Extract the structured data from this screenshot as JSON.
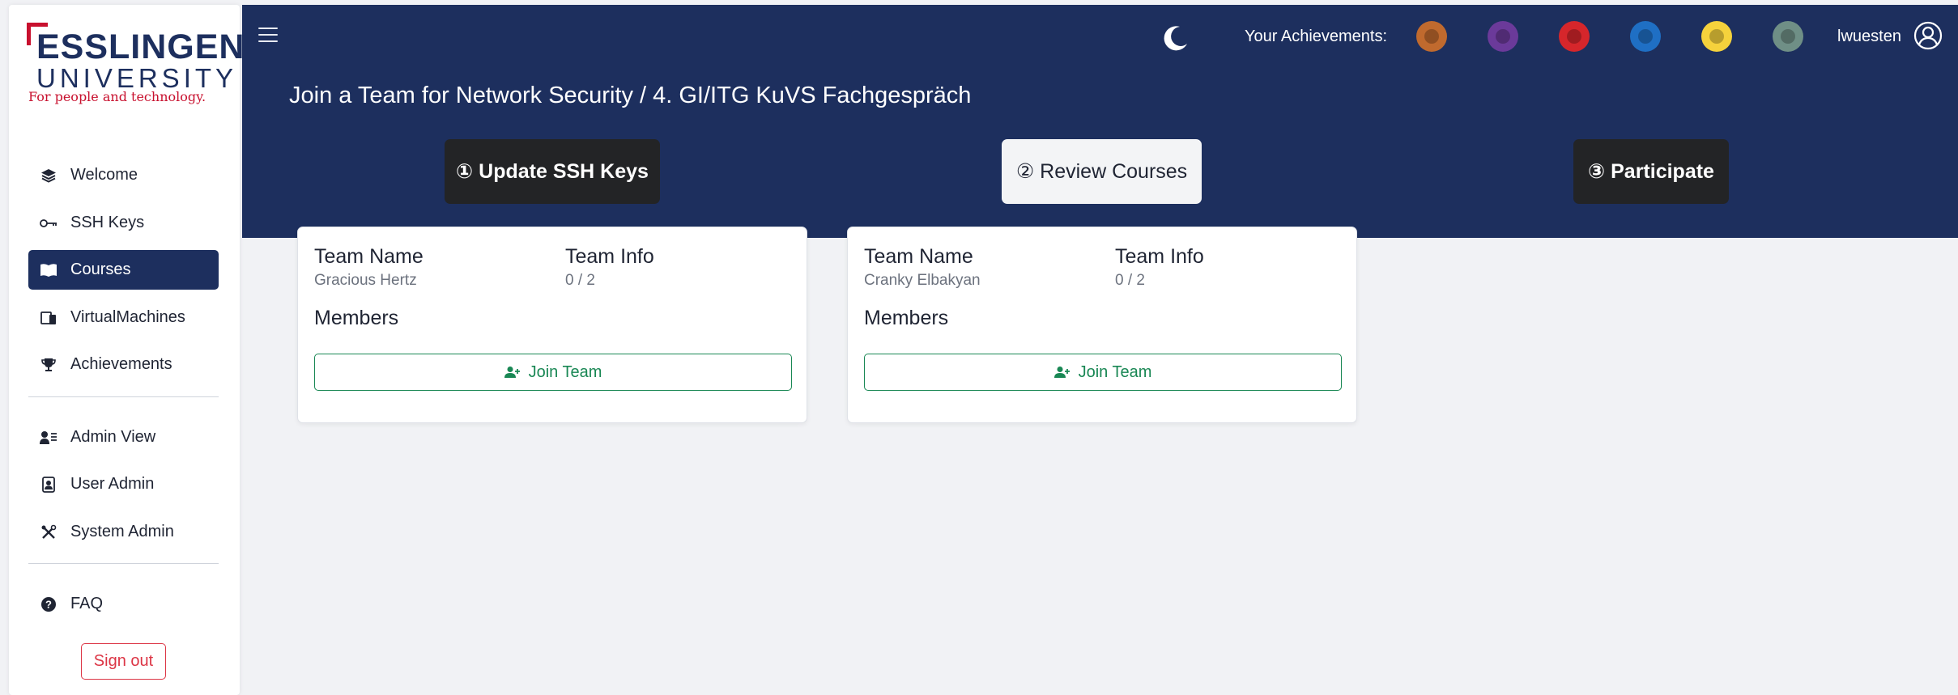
{
  "logo": {
    "title": "ESSLINGEN",
    "subtitle": "UNIVERSITY",
    "tagline": "For people and technology."
  },
  "sidebar": {
    "items": [
      {
        "label": "Welcome",
        "icon": "layers-icon"
      },
      {
        "label": "SSH Keys",
        "icon": "key-icon"
      },
      {
        "label": "Courses",
        "icon": "book-icon",
        "active": true
      },
      {
        "label": "VirtualMachines",
        "icon": "devices-icon"
      },
      {
        "label": "Achievements",
        "icon": "trophy-icon"
      },
      {
        "label": "Admin View",
        "icon": "user-list-icon"
      },
      {
        "label": "User Admin",
        "icon": "user-badge-icon"
      },
      {
        "label": "System Admin",
        "icon": "tools-icon"
      },
      {
        "label": "FAQ",
        "icon": "question-circle-icon"
      }
    ],
    "sign_out": "Sign out"
  },
  "header": {
    "achievements_label": "Your Achievements:",
    "badges": [
      {
        "color": "#c06a2e"
      },
      {
        "color": "#6b3a9a"
      },
      {
        "color": "#d6262b"
      },
      {
        "color": "#1f6fc4"
      },
      {
        "color": "#f5d23c"
      },
      {
        "color": "#6f8f86"
      }
    ],
    "username": "lwuesten"
  },
  "page": {
    "title": "Join a Team for Network Security / 4. GI/ITG KuVS Fachgespräch",
    "steps": [
      {
        "label": "① Update SSH Keys"
      },
      {
        "label": "② Review Courses"
      },
      {
        "label": "③ Participate"
      }
    ]
  },
  "teams": [
    {
      "name_header": "Team Name",
      "name": "Gracious Hertz",
      "info_header": "Team Info",
      "info": "0 / 2",
      "members_header": "Members",
      "join_label": "Join Team"
    },
    {
      "name_header": "Team Name",
      "name": "Cranky Elbakyan",
      "info_header": "Team Info",
      "info": "0 / 2",
      "members_header": "Members",
      "join_label": "Join Team"
    }
  ]
}
